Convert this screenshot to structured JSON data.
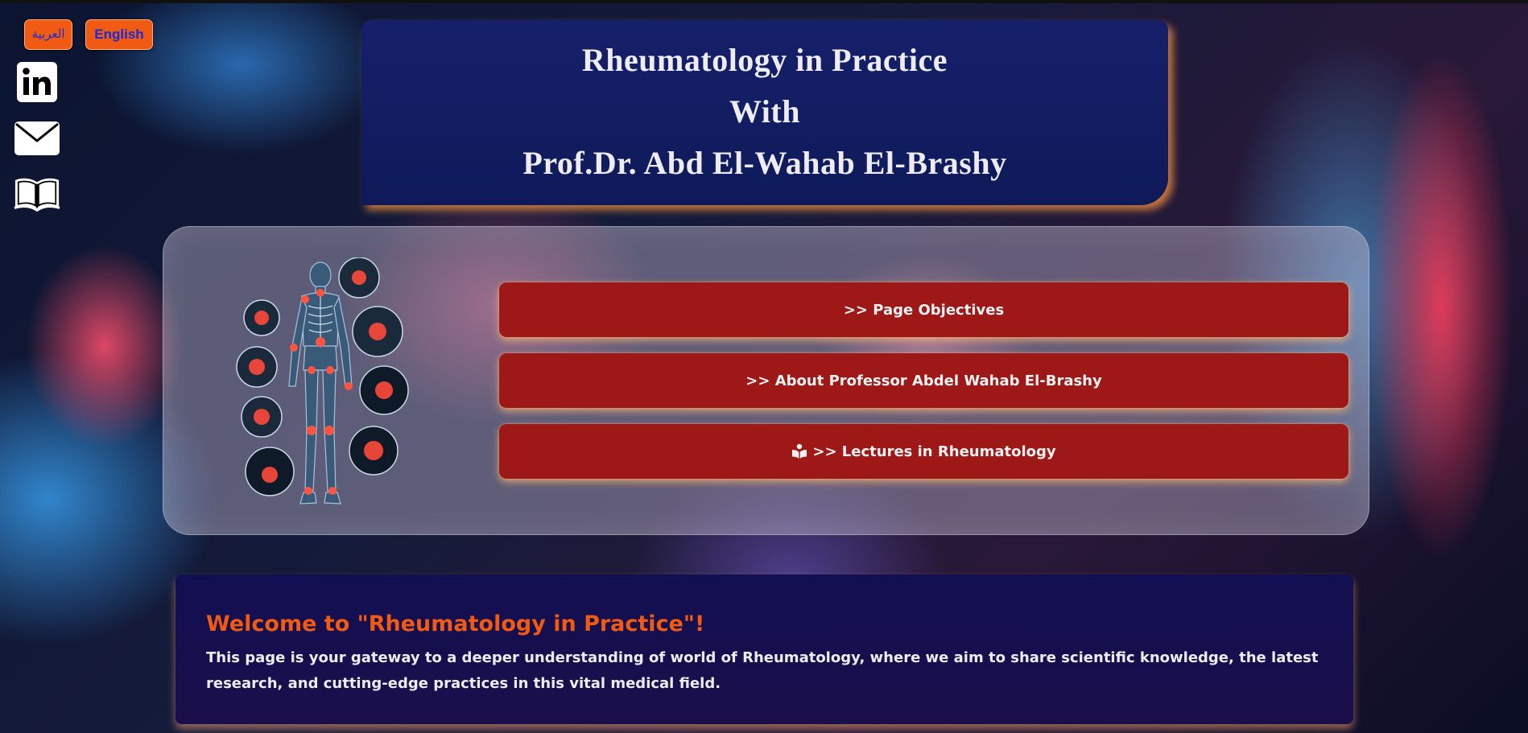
{
  "language": {
    "arabic_label": "العربية",
    "english_label": "English"
  },
  "social": {
    "linkedin_icon": "linkedin-icon",
    "mail_icon": "mail-icon",
    "book_icon": "book-icon"
  },
  "header": {
    "line1": "Rheumatology in Practice",
    "line2": "With",
    "line3": "Prof.Dr. Abd El-Wahab El-Brashy"
  },
  "nav": {
    "objectives": ">> Page Objectives",
    "about": ">> About Professor Abdel Wahab El-Brashy",
    "lectures": ">> Lectures in Rheumatology",
    "lectures_icon": "book-reader-icon"
  },
  "welcome": {
    "title": "Welcome to \"Rheumatology in Practice\"!",
    "text": "This page is your gateway to a deeper understanding of world of Rheumatology, where we aim to share scientific knowledge, the latest research, and cutting-edge practices in this vital medical field."
  },
  "colors": {
    "accent_orange": "#f05a12",
    "button_red": "#9e1818",
    "header_navy": "#16206a",
    "welcome_navy": "#120f52"
  }
}
